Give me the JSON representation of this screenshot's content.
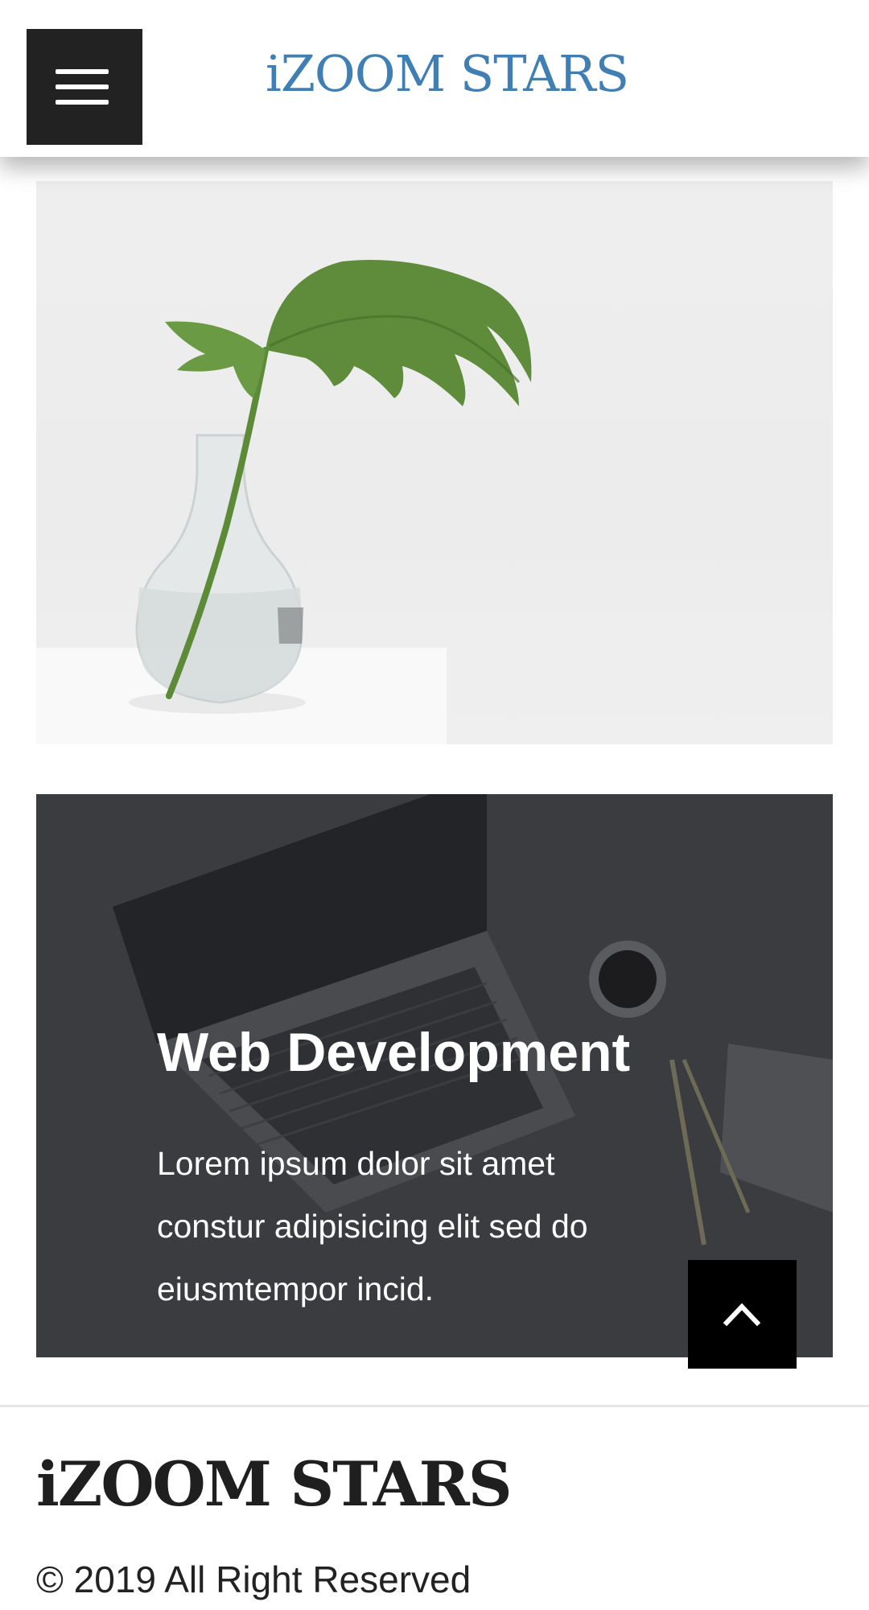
{
  "header": {
    "brand": "iZOOM STARS",
    "menu_icon": "hamburger-menu-icon",
    "brand_color": "#3f7fb4"
  },
  "cards": [
    {
      "image": "plant-in-glass-vase"
    },
    {
      "image": "laptop-on-desk",
      "title": "Web Development",
      "text": "Lorem ipsum dolor sit amet constur adipisicing elit sed do eiusmtempor incid."
    }
  ],
  "back_to_top": {
    "icon": "chevron-up-icon"
  },
  "footer": {
    "brand": "iZOOM STARS",
    "copyright": "© 2019 All Right Reserved"
  }
}
